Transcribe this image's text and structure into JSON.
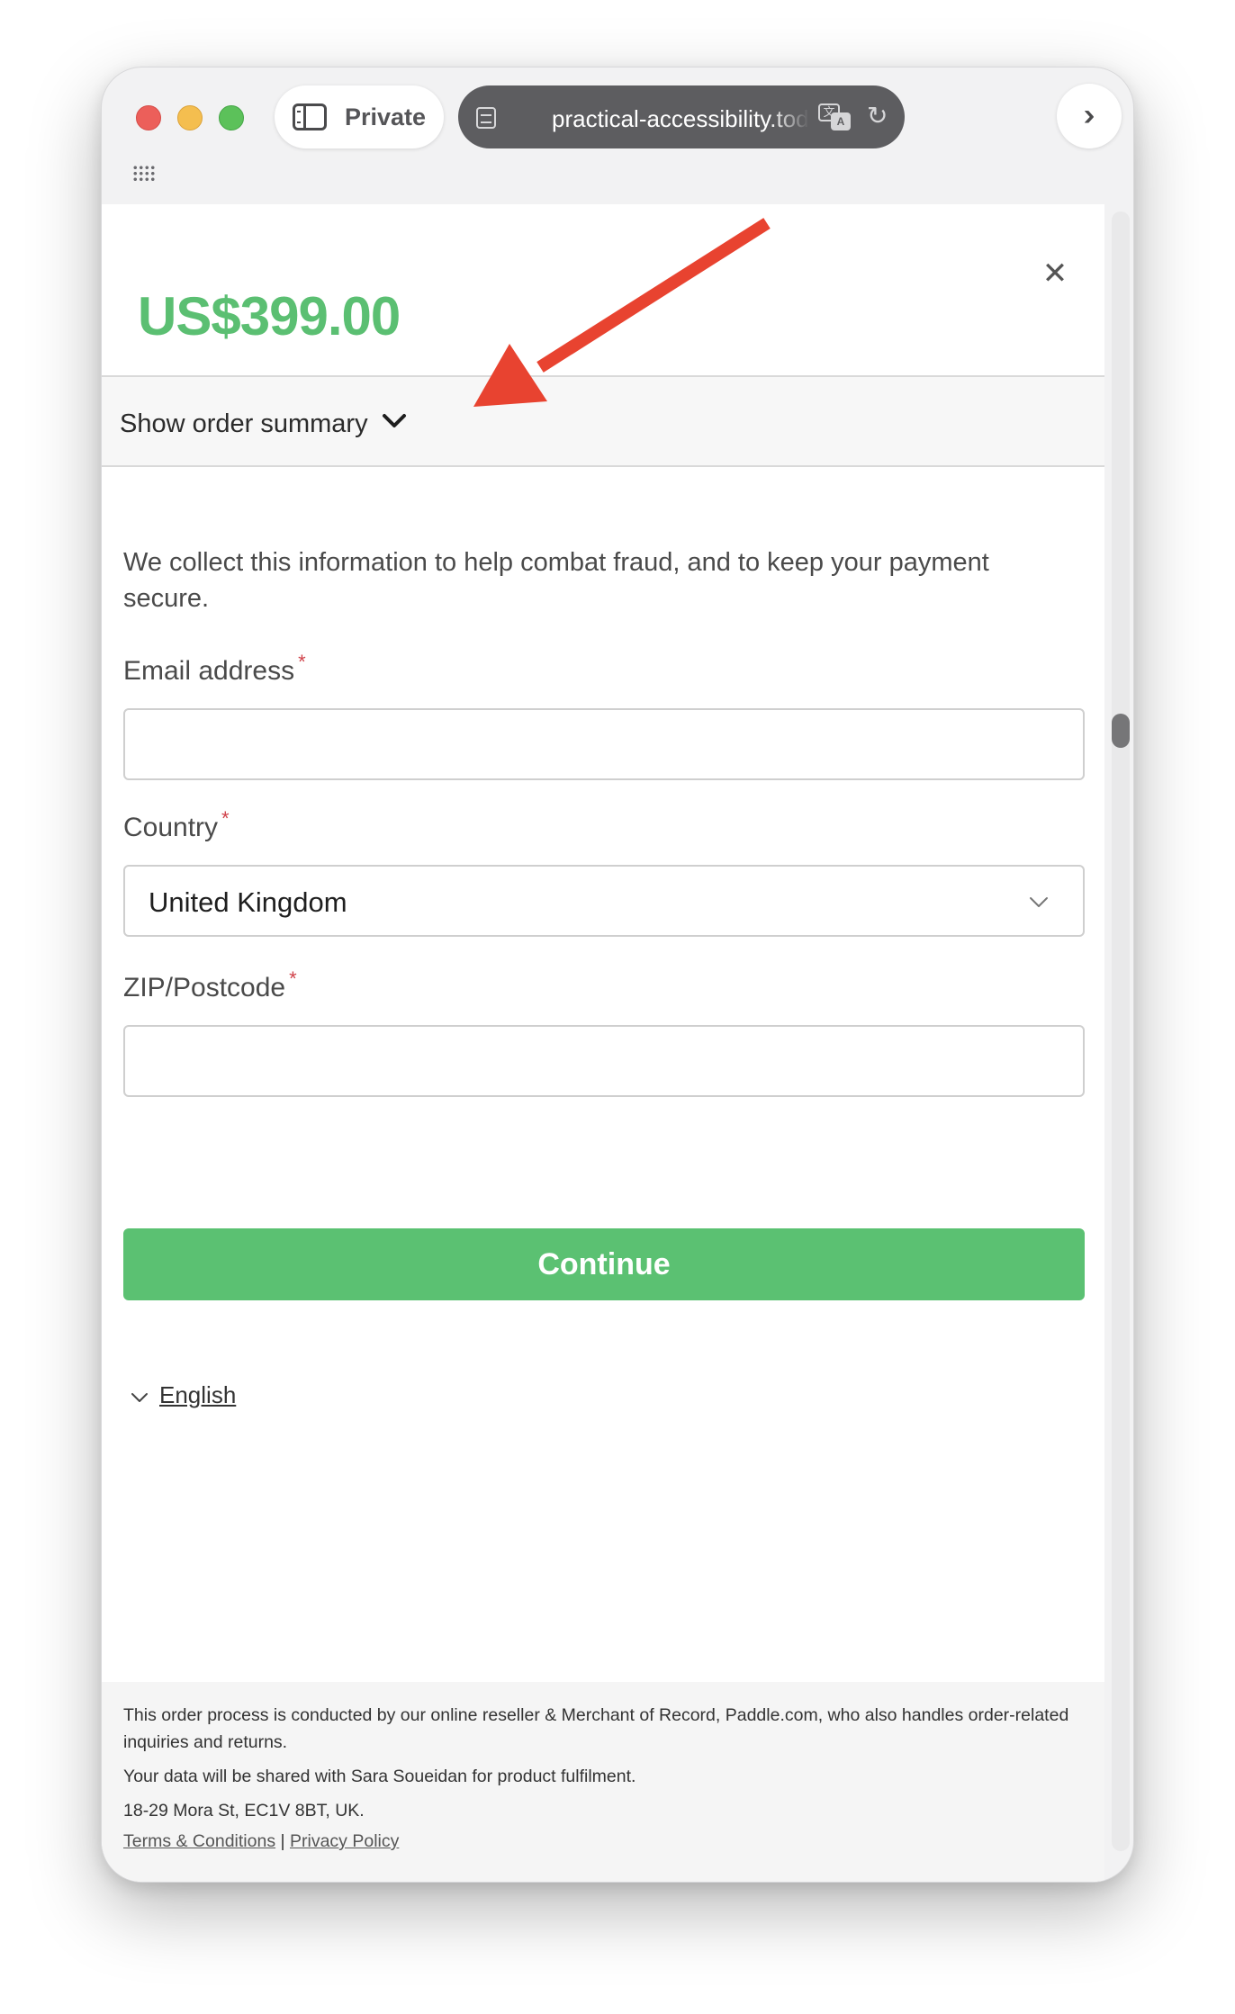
{
  "browser": {
    "private_label": "Private",
    "url": "practical-accessibility.today",
    "reload_icon": "reload-icon",
    "translate_icon": "translate-icon"
  },
  "checkout": {
    "price": "US$399.00",
    "close_icon": "close-icon",
    "summary_toggle": "Show order summary",
    "info_text": "We collect this information to help combat fraud, and to keep your payment secure.",
    "email_label": "Email address",
    "email_value": "",
    "country_label": "Country",
    "country_value": "United Kingdom",
    "zip_label": "ZIP/Postcode",
    "zip_value": "",
    "required_marker": "*",
    "continue_label": "Continue",
    "language": "English"
  },
  "footer": {
    "reseller_text": "This order process is conducted by our online reseller & Merchant of Record, Paddle.com, who also handles order-related inquiries and returns.",
    "data_share_text": "Your data will be shared with Sara Soueidan for product fulfilment.",
    "address": "18-29 Mora St, EC1V 8BT, UK.",
    "terms_link": "Terms & Conditions",
    "separator": "|",
    "privacy_link": "Privacy Policy"
  },
  "colors": {
    "accent_green": "#5bc172",
    "annotation_arrow": "#e84330"
  }
}
